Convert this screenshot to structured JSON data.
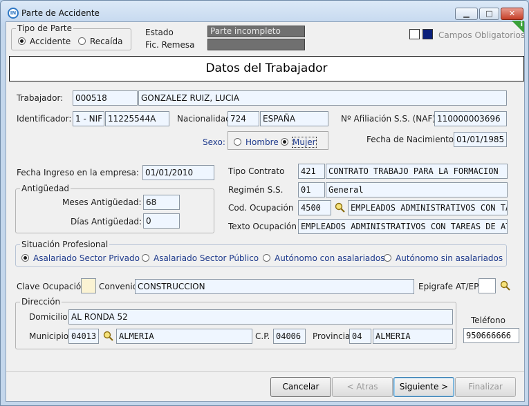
{
  "window": {
    "title": "Parte de Accidente",
    "app_icon_text": "IN"
  },
  "tipo_parte": {
    "label": "Tipo de Parte",
    "options": [
      "Accidente",
      "Recaída"
    ],
    "selected": "Accidente"
  },
  "estado": {
    "label": "Estado",
    "value": "Parte incompleto"
  },
  "fic_remesa": {
    "label": "Fic. Remesa",
    "value": ""
  },
  "campos_obligatorios": {
    "label": "Campos Obligatorios",
    "info_glyph": "i"
  },
  "banner_title": "Datos del Trabajador",
  "trabajador": {
    "label": "Trabajador:",
    "code": "000518",
    "name": "GONZALEZ RUIZ, LUCIA"
  },
  "identificador": {
    "label": "Identificador:",
    "type": "1 - NIF",
    "value": "11225544A"
  },
  "nacionalidad": {
    "label": "Nacionalidad:",
    "code": "724",
    "name": "ESPAÑA"
  },
  "afiliacion": {
    "label": "Nº Afiliación S.S. (NAF):",
    "value": "110000003696"
  },
  "sexo": {
    "label": "Sexo:",
    "options": [
      "Hombre",
      "Mujer"
    ],
    "selected": "Mujer"
  },
  "fecha_nacimiento": {
    "label": "Fecha de Nacimiento:",
    "value": "01/01/1985"
  },
  "fecha_ingreso": {
    "label": "Fecha Ingreso en la empresa:",
    "value": "01/01/2010"
  },
  "antiguedad": {
    "legend": "Antigüedad",
    "meses_label": "Meses Antigüedad:",
    "meses": "68",
    "dias_label": "Días Antigüedad:",
    "dias": "0"
  },
  "tipo_contrato": {
    "label": "Tipo Contrato",
    "code": "421",
    "name": "CONTRATO TRABAJO PARA LA FORMACION"
  },
  "regimen": {
    "label": "Regimén S.S.",
    "code": "01",
    "name": "General"
  },
  "cod_ocupacion": {
    "label": "Cod. Ocupación",
    "code": "4500",
    "name": "EMPLEADOS ADMINISTRATIVOS CON TA"
  },
  "texto_ocupacion": {
    "label": "Texto Ocupación",
    "value": "EMPLEADOS ADMINISTRATIVOS CON TAREAS DE AT"
  },
  "situacion": {
    "legend": "Situación Profesional",
    "options": [
      "Asalariado Sector Privado",
      "Asalariado Sector Público",
      "Autónomo con asalariados",
      "Autónomo sin asalariados"
    ],
    "selected": "Asalariado Sector Privado"
  },
  "clave_ocupacion": {
    "label": "Clave Ocupación",
    "value": ""
  },
  "convenio": {
    "label": "Convenio",
    "value": "CONSTRUCCION"
  },
  "epigrafe": {
    "label": "Epigrafe AT/EP",
    "value": ""
  },
  "direccion": {
    "legend": "Dirección",
    "domicilio_label": "Domicilio",
    "domicilio": "AL RONDA 52",
    "municipio_label": "Municipio",
    "municipio_code": "04013",
    "municipio_name": "ALMERIA",
    "cp_label": "C.P.",
    "cp": "04006",
    "provincia_label": "Provincia",
    "provincia_code": "04",
    "provincia_name": "ALMERIA"
  },
  "telefono": {
    "label": "Teléfono",
    "value": "950666666"
  },
  "buttons": {
    "cancelar": "Cancelar",
    "atras": "< Atras",
    "siguiente": "Siguiente >",
    "finalizar": "Finalizar"
  },
  "colors": {
    "required_marker": "#0a1f7a",
    "accent_blue": "#1e3a8c",
    "info_green": "#3aa13a"
  }
}
